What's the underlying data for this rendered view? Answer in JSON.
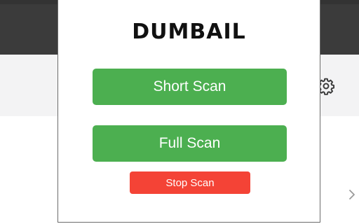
{
  "popup": {
    "logo_text": "DUMBAIL",
    "buttons": {
      "short_scan": "Short Scan",
      "full_scan": "Full Scan",
      "stop_scan": "Stop Scan"
    }
  },
  "icons": {
    "settings": "gear-icon",
    "next": "chevron-right-icon"
  },
  "colors": {
    "scan_button": "#4caf50",
    "stop_button": "#f44336",
    "top_bar": "#3b3b3b",
    "toolbar": "#f3f3f4"
  }
}
